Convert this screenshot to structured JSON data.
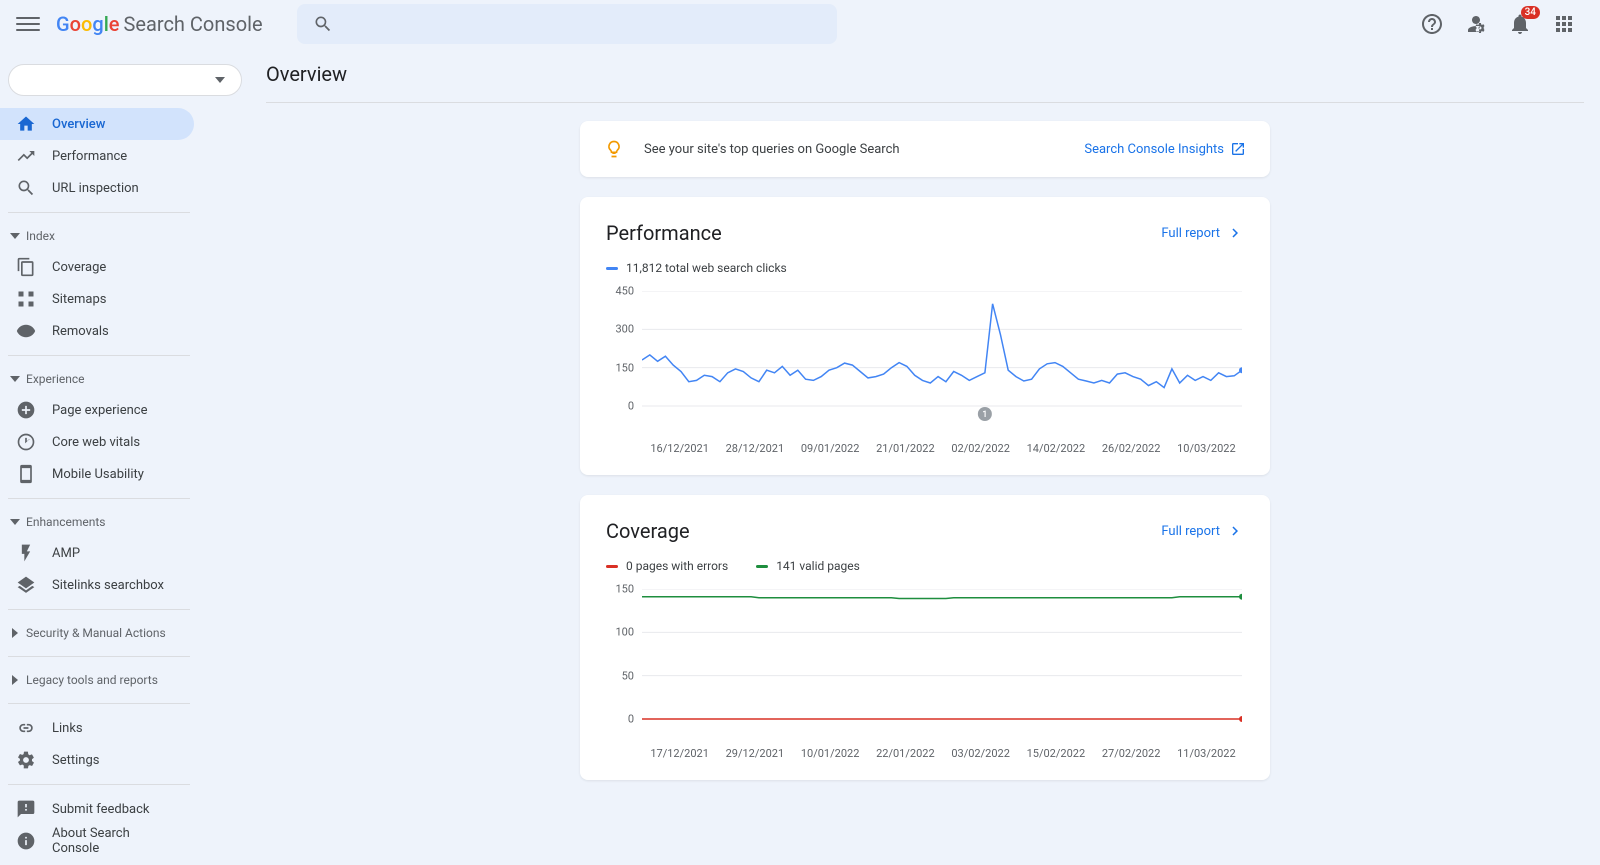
{
  "app_name": "Search Console",
  "notification_count": "34",
  "page_title": "Overview",
  "sidebar": {
    "items_top": [
      {
        "label": "Overview",
        "icon": "home"
      },
      {
        "label": "Performance",
        "icon": "trending"
      },
      {
        "label": "URL inspection",
        "icon": "search"
      }
    ],
    "section_index": "Index",
    "items_index": [
      {
        "label": "Coverage",
        "icon": "copy"
      },
      {
        "label": "Sitemaps",
        "icon": "sitemap"
      },
      {
        "label": "Removals",
        "icon": "removal"
      }
    ],
    "section_experience": "Experience",
    "items_experience": [
      {
        "label": "Page experience",
        "icon": "plus-circle"
      },
      {
        "label": "Core web vitals",
        "icon": "speed"
      },
      {
        "label": "Mobile Usability",
        "icon": "phone"
      }
    ],
    "section_enhancements": "Enhancements",
    "items_enhancements": [
      {
        "label": "AMP",
        "icon": "bolt"
      },
      {
        "label": "Sitelinks searchbox",
        "icon": "layers"
      }
    ],
    "section_security": "Security & Manual Actions",
    "section_legacy": "Legacy tools and reports",
    "items_footer": [
      {
        "label": "Links",
        "icon": "link"
      },
      {
        "label": "Settings",
        "icon": "gear"
      }
    ],
    "items_footer2": [
      {
        "label": "Submit feedback",
        "icon": "feedback"
      },
      {
        "label": "About Search Console",
        "icon": "info"
      }
    ]
  },
  "insights": {
    "text": "See your site's top queries on Google Search",
    "link": "Search Console Insights"
  },
  "performance": {
    "title": "Performance",
    "full_report": "Full report",
    "legend": "11,812 total web search clicks"
  },
  "coverage": {
    "title": "Coverage",
    "full_report": "Full report",
    "legend_errors": "0 pages with errors",
    "legend_valid": "141 valid pages"
  },
  "chart_data": [
    {
      "type": "line",
      "title": "Performance",
      "ylabel": "",
      "xlabel": "",
      "ylim": [
        0,
        450
      ],
      "y_ticks": [
        0,
        150,
        300,
        450
      ],
      "x_ticks": [
        "16/12/2021",
        "28/12/2021",
        "09/01/2022",
        "21/01/2022",
        "02/02/2022",
        "14/02/2022",
        "26/02/2022",
        "10/03/2022"
      ],
      "marker": {
        "x_index": 4,
        "label": "1"
      },
      "series": [
        {
          "name": "total web search clicks",
          "color": "#4285f4",
          "values": [
            180,
            200,
            175,
            195,
            160,
            135,
            95,
            100,
            120,
            115,
            95,
            130,
            145,
            135,
            110,
            95,
            140,
            130,
            155,
            120,
            140,
            105,
            100,
            115,
            140,
            150,
            168,
            160,
            135,
            110,
            115,
            125,
            150,
            170,
            155,
            120,
            100,
            90,
            115,
            95,
            135,
            120,
            100,
            115,
            130,
            400,
            280,
            140,
            115,
            98,
            105,
            145,
            165,
            170,
            155,
            130,
            105,
            98,
            90,
            100,
            90,
            125,
            130,
            115,
            105,
            80,
            95,
            72,
            145,
            90,
            120,
            100,
            115,
            100,
            130,
            115,
            118,
            140
          ]
        }
      ]
    },
    {
      "type": "line",
      "title": "Coverage",
      "ylabel": "",
      "xlabel": "",
      "ylim": [
        0,
        150
      ],
      "y_ticks": [
        0,
        50,
        100,
        150
      ],
      "x_ticks": [
        "17/12/2021",
        "29/12/2021",
        "10/01/2022",
        "22/01/2022",
        "03/02/2022",
        "15/02/2022",
        "27/02/2022",
        "11/03/2022"
      ],
      "series": [
        {
          "name": "pages with errors",
          "color": "#d93025",
          "values": [
            0,
            0,
            0,
            0,
            0,
            0,
            0,
            0,
            0,
            0,
            0,
            0,
            0,
            0,
            0,
            0,
            0,
            0,
            0,
            0,
            0,
            0,
            0,
            0,
            0,
            0,
            0,
            0,
            0,
            0,
            0,
            0,
            0,
            0,
            0,
            0,
            0,
            0,
            0,
            0,
            0,
            0,
            0,
            0,
            0,
            0,
            0,
            0,
            0,
            0,
            0,
            0,
            0,
            0,
            0,
            0,
            0,
            0,
            0,
            0,
            0,
            0,
            0,
            0,
            0,
            0,
            0,
            0,
            0,
            0,
            0,
            0,
            0,
            0,
            0,
            0,
            0,
            0
          ]
        },
        {
          "name": "valid pages",
          "color": "#1e8e3e",
          "values": [
            141,
            141,
            141,
            141,
            141,
            141,
            141,
            141,
            141,
            141,
            141,
            141,
            141,
            141,
            141,
            140,
            140,
            140,
            140,
            140,
            140,
            140,
            140,
            140,
            140,
            140,
            140,
            140,
            140,
            140,
            140,
            140,
            140,
            139,
            139,
            139,
            139,
            139,
            139,
            139,
            140,
            140,
            140,
            140,
            140,
            140,
            140,
            140,
            140,
            140,
            140,
            140,
            140,
            140,
            140,
            140,
            140,
            140,
            140,
            140,
            140,
            140,
            140,
            140,
            140,
            140,
            140,
            140,
            140,
            141,
            141,
            141,
            141,
            141,
            141,
            141,
            141,
            141
          ]
        }
      ]
    }
  ]
}
